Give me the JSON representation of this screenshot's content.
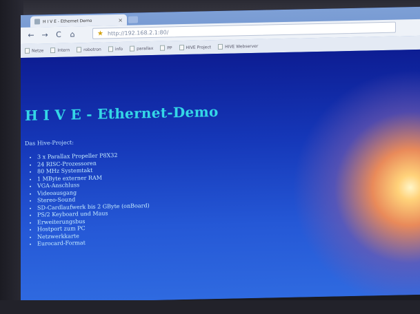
{
  "browser": {
    "tab_title": "H I V E - Ethernet Demo",
    "tab_close": "×",
    "address": "http://192.168.2.1:80/",
    "nav": {
      "back": "←",
      "forward": "→",
      "reload": "C",
      "home": "⌂",
      "star": "★"
    },
    "bookmarks": [
      "Netze",
      "Intern",
      "robotron",
      "info",
      "parallax",
      "PP",
      "HIVE Project",
      "HIVE Webserver"
    ]
  },
  "page": {
    "heading": "H I V E - Ethernet-Demo",
    "intro": "Das Hive-Project:",
    "features": [
      "3 x Parallax Propeller P8X32",
      "24 RISC-Prozessoren",
      "80 MHz Systemtakt",
      "1 MByte externer RAM",
      "VGA-Anschluss",
      "Videoausgang",
      "Stereo-Sound",
      "SD-Cardlaufwerk bis 2 GByte (onBoard)",
      "PS/2 Keyboard und Maus",
      "Erweiterungsbus",
      "Hostport zum PC",
      "Netzwerkkarte",
      "Eurocard-Format"
    ]
  },
  "colors": {
    "heading": "#34d7e6",
    "text": "#c8eeff",
    "page_top": "#0d1d93",
    "page_bottom": "#2f6ae0"
  }
}
